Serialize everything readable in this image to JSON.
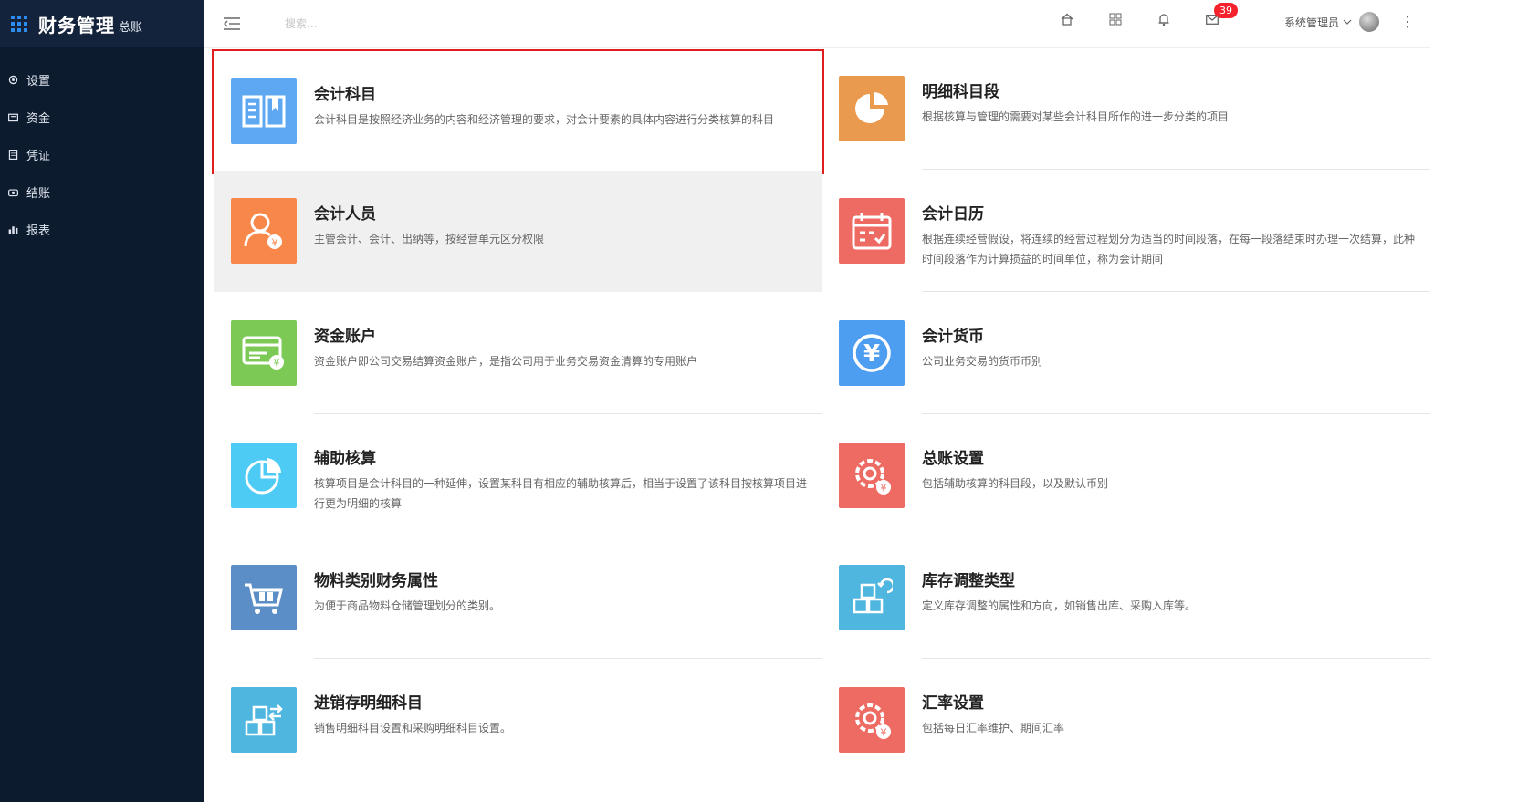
{
  "app": {
    "title": "财务管理",
    "subtitle": "总账"
  },
  "sidebar": {
    "items": [
      {
        "label": "设置",
        "icon": "gear-icon"
      },
      {
        "label": "资金",
        "icon": "funds-icon"
      },
      {
        "label": "凭证",
        "icon": "voucher-icon"
      },
      {
        "label": "结账",
        "icon": "checkout-icon"
      },
      {
        "label": "报表",
        "icon": "report-icon"
      }
    ]
  },
  "header": {
    "search_placeholder": "搜索...",
    "mail_badge": "39",
    "user_name": "系统管理员"
  },
  "colors": {
    "sidebar": "#0d1b2e",
    "accent": "#2d8cf0",
    "badge": "#f5222d",
    "selection": "#e01e1e"
  },
  "cards": [
    {
      "title": "会计科目",
      "desc": "会计科目是按照经济业务的内容和经济管理的要求，对会计要素的具体内容进行分类核算的科目",
      "color": "#5ea8f2",
      "icon": "book-icon"
    },
    {
      "title": "明细科目段",
      "desc": "根据核算与管理的需要对某些会计科目所作的进一步分类的项目",
      "color": "#ea9a4e",
      "icon": "pie-chart-icon"
    },
    {
      "title": "会计人员",
      "desc": "主管会计、会计、出纳等，按经营单元区分权限",
      "color": "#f7884a",
      "icon": "accountant-icon"
    },
    {
      "title": "会计日历",
      "desc": "根据连续经营假设，将连续的经营过程划分为适当的时间段落，在每一段落结束时办理一次结算，此种时间段落作为计算损益的时间单位，称为会计期间",
      "color": "#ed6b62",
      "icon": "calendar-icon"
    },
    {
      "title": "资金账户",
      "desc": "资金账户即公司交易结算资金账户，是指公司用于业务交易资金清算的专用账户",
      "color": "#7dc955",
      "icon": "account-card-icon"
    },
    {
      "title": "会计货币",
      "desc": "公司业务交易的货币币别",
      "color": "#4d9df1",
      "icon": "yen-icon"
    },
    {
      "title": "辅助核算",
      "desc": "核算项目是会计科目的一种延伸，设置某科目有相应的辅助核算后，相当于设置了该科目按核算项目进行更为明细的核算",
      "color": "#4dcbf4",
      "icon": "pie-chart-icon"
    },
    {
      "title": "总账设置",
      "desc": "包括辅助核算的科目段，以及默认币别",
      "color": "#ed6b62",
      "icon": "gear-yen-icon"
    },
    {
      "title": "物料类别财务属性",
      "desc": "为便于商品物料仓储管理划分的类别。",
      "color": "#5b8ec6",
      "icon": "cart-icon"
    },
    {
      "title": "库存调整类型",
      "desc": "定义库存调整的属性和方向，如销售出库、采购入库等。",
      "color": "#4fb6df",
      "icon": "boxes-icon"
    },
    {
      "title": "进销存明细科目",
      "desc": "销售明细科目设置和采购明细科目设置。",
      "color": "#4fb6df",
      "icon": "boxes-arrow-icon"
    },
    {
      "title": "汇率设置",
      "desc": "包括每日汇率维护、期间汇率",
      "color": "#ed6b62",
      "icon": "gear-yen-icon"
    }
  ]
}
